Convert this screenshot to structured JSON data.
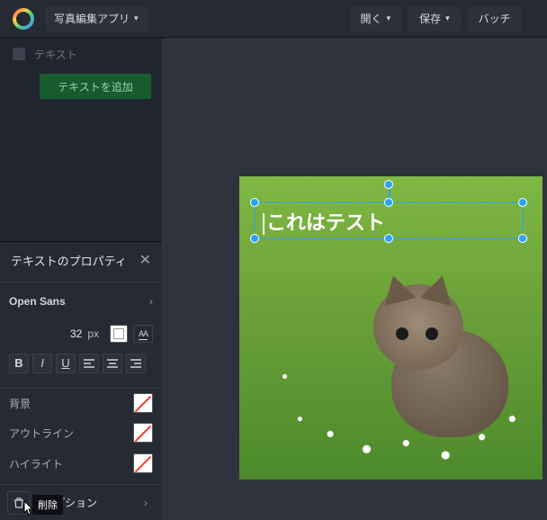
{
  "header": {
    "app_menu": "写真編集アプリ",
    "open": "開く",
    "save": "保存",
    "batch": "バッチ"
  },
  "sidebar": {
    "tool_label": "テキスト",
    "add_text": "テキストを追加"
  },
  "properties": {
    "title": "テキストのプロパティ",
    "font_family": "Open Sans",
    "font_size": "32",
    "font_unit": "px",
    "caps": "AA",
    "bold": "B",
    "italic": "I",
    "underline": "U",
    "background": "背景",
    "outline": "アウトライン",
    "highlight": "ハイライト",
    "options": "オプション",
    "delete_tooltip": "削除"
  },
  "canvas": {
    "text": "これはテスト"
  }
}
